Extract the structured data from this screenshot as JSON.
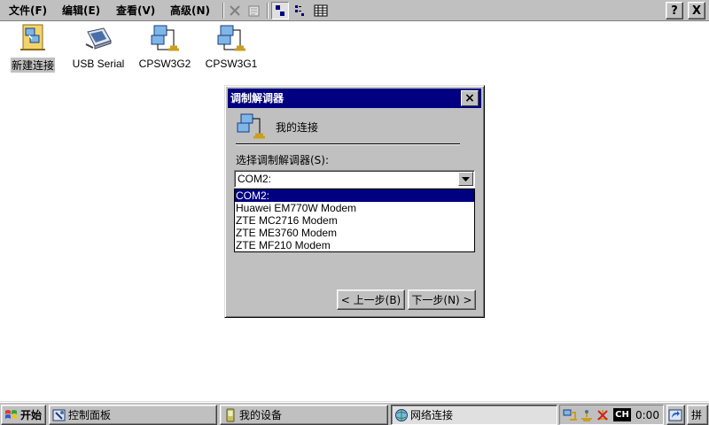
{
  "menubar": {
    "menus": [
      "文件(F)",
      "编辑(E)",
      "查看(V)",
      "高级(N)"
    ],
    "help_label": "?",
    "close_label": "X"
  },
  "desktop": {
    "icons": [
      {
        "label": "新建连接",
        "icon": "make-new-connection-icon"
      },
      {
        "label": "USB Serial",
        "icon": "usb-serial-connection-icon"
      },
      {
        "label": "CPSW3G2",
        "icon": "network-adapter-icon"
      },
      {
        "label": "CPSW3G1",
        "icon": "network-adapter-icon"
      }
    ]
  },
  "dialog": {
    "title": "调制解调器",
    "close_label": "×",
    "connection_name": "我的连接",
    "modem_label": "选择调制解调器(S):",
    "selected_modem": "COM2:",
    "modem_options": [
      "COM2:",
      "Huawei EM770W Modem",
      "ZTE MC2716 Modem",
      "ZTE ME3760 Modem",
      "ZTE MF210 Modem"
    ],
    "back_label": "< 上一步(B)",
    "next_label": "下一步(N) >"
  },
  "taskbar": {
    "start_label": "开始",
    "tasks": [
      {
        "label": "控制面板",
        "icon": "control-panel-icon"
      },
      {
        "label": "我的设备",
        "icon": "my-device-icon"
      },
      {
        "label": "网络连接",
        "icon": "network-connections-icon"
      }
    ],
    "tray": {
      "input_lang": "CH",
      "time": "0:00"
    },
    "ime_label": "拼"
  },
  "colors": {
    "face": "#c0c0c0",
    "titlebar": "#000080",
    "highlight": "#000080",
    "desktop": "#ffffff"
  }
}
